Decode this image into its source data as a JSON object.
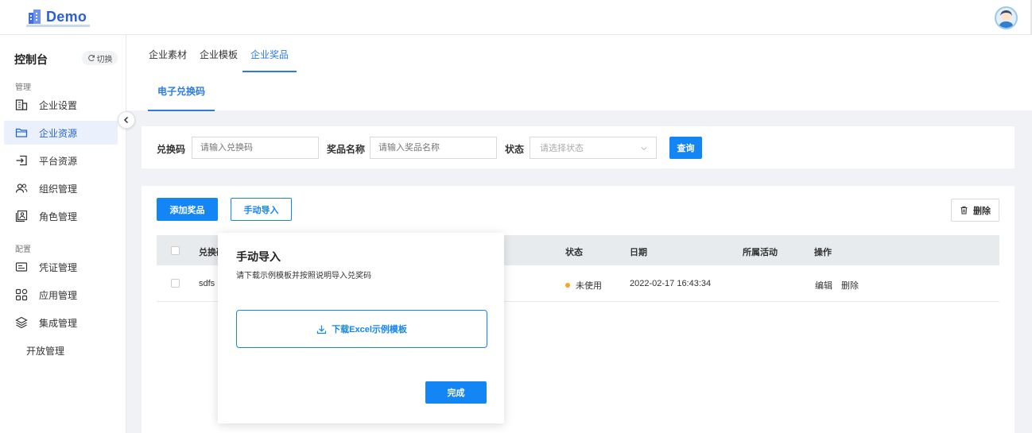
{
  "app": {
    "logo_text": "Demo",
    "brand_color": "#2b5fd9",
    "accent_color": "#1485f5"
  },
  "sidebar": {
    "title": "控制台",
    "switch_label": "切换",
    "groups": [
      {
        "label": "管理"
      },
      {
        "label": "配置"
      }
    ],
    "items": [
      {
        "label": "企业设置",
        "icon": "building-icon"
      },
      {
        "label": "企业资源",
        "icon": "folder-icon",
        "active": true
      },
      {
        "label": "平台资源",
        "icon": "import-icon"
      },
      {
        "label": "组织管理",
        "icon": "users-icon"
      },
      {
        "label": "角色管理",
        "icon": "role-card-icon"
      },
      {
        "label": "凭证管理",
        "icon": "credential-icon"
      },
      {
        "label": "应用管理",
        "icon": "apps-grid-icon"
      },
      {
        "label": "集成管理",
        "icon": "layers-icon"
      },
      {
        "label": "开放管理",
        "icon": ""
      }
    ]
  },
  "tabs": [
    {
      "label": "企业素材"
    },
    {
      "label": "企业模板"
    },
    {
      "label": "企业奖品",
      "active": true
    }
  ],
  "subtab": {
    "label": "电子兑换码"
  },
  "filter": {
    "code_label": "兑换码",
    "code_placeholder": "请输入兑换码",
    "prize_label": "奖品名称",
    "prize_placeholder": "请输入奖品名称",
    "status_label": "状态",
    "status_placeholder": "请选择状态",
    "query_button": "查询"
  },
  "toolbar": {
    "add_button": "添加奖品",
    "import_button": "手动导入",
    "delete_button": "删除"
  },
  "table": {
    "columns": [
      "兑换码",
      "状态",
      "日期",
      "所属活动",
      "操作"
    ],
    "rows": [
      {
        "code": "sdfs",
        "status": "未使用",
        "date": "2022-02-17 16:43:34",
        "activity": "",
        "edit": "编辑",
        "delete": "删除"
      }
    ]
  },
  "popover": {
    "title": "手动导入",
    "description": "请下载示例模板并按照说明导入兑奖码",
    "download_label": "下载Excel示例模板",
    "done_button": "完成"
  }
}
